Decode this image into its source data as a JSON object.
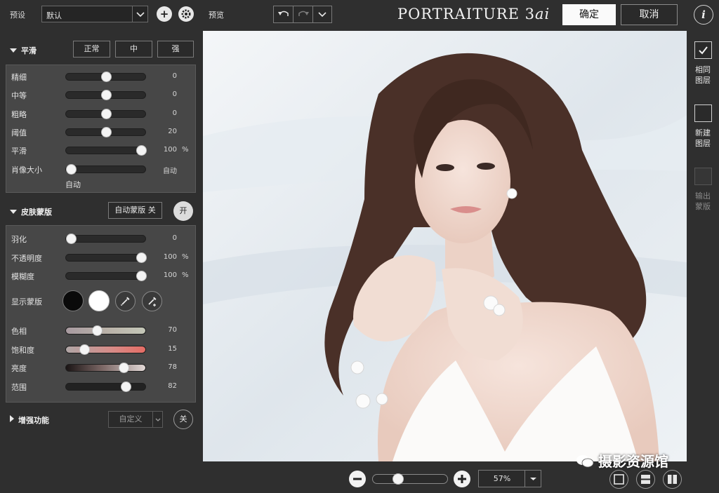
{
  "top": {
    "preset_label": "预设",
    "preset_value": "默认",
    "preview_label": "预览",
    "brand_main": "PORTRAITURE 3",
    "brand_suffix": "ai",
    "ok_label": "确定",
    "cancel_label": "取消",
    "info_glyph": "i"
  },
  "smoothing": {
    "title": "平滑",
    "modes": [
      "正常",
      "中",
      "强"
    ],
    "sliders": [
      {
        "label": "精细",
        "value": "0",
        "unit": "",
        "level": 0.5
      },
      {
        "label": "中等",
        "value": "0",
        "unit": "",
        "level": 0.5
      },
      {
        "label": "粗略",
        "value": "0",
        "unit": "",
        "level": 0.5
      },
      {
        "label": "阈值",
        "value": "20",
        "unit": "",
        "level": 0.5
      },
      {
        "label": "平滑",
        "value": "100",
        "unit": "%",
        "level": 1.0
      },
      {
        "label": "肖像大小",
        "value": "自动",
        "unit": "",
        "level": 0.0
      }
    ],
    "portrait_size_note": "自动"
  },
  "skin_mask": {
    "title": "皮肤蒙版",
    "auto_mask_label": "自动蒙版 关",
    "toggle_label": "开",
    "sliders": [
      {
        "label": "羽化",
        "value": "0",
        "unit": "",
        "level": 0.0
      },
      {
        "label": "不透明度",
        "value": "100",
        "unit": "%",
        "level": 1.0
      },
      {
        "label": "模糊度",
        "value": "100",
        "unit": "%",
        "level": 1.0
      }
    ],
    "show_mask_label": "显示蒙版",
    "color_sliders": [
      {
        "label": "色相",
        "value": "70",
        "level": 0.37,
        "gradient": "linear-gradient(90deg,#a89aa0,#b9b1a8 50%,#c4c7b8)"
      },
      {
        "label": "饱和度",
        "value": "15",
        "level": 0.19,
        "gradient": "linear-gradient(90deg,#b0a6a6,#d88a86 60%,#e56d65)"
      },
      {
        "label": "亮度",
        "value": "78",
        "level": 0.75,
        "gradient": "linear-gradient(90deg,#1a1414,#7a6664 45%,#e2d8d6)"
      },
      {
        "label": "范围",
        "value": "82",
        "level": 0.78,
        "gradient": "linear-gradient(90deg,#222,#222)"
      }
    ]
  },
  "enhance": {
    "title": "增强功能",
    "preset_value": "自定义",
    "toggle_label": "关"
  },
  "side": {
    "same_layer": [
      "相同",
      "图层"
    ],
    "new_layer": [
      "新建",
      "图层"
    ],
    "output_mask": [
      "输出",
      "蒙版"
    ]
  },
  "bottom": {
    "zoom_value": "57%",
    "zoom_level": 0.3
  },
  "watermark": "摄影资源馆",
  "colors": {
    "panel": "#2f2f2f",
    "group": "#474747",
    "accent": "#f4f4f4"
  }
}
